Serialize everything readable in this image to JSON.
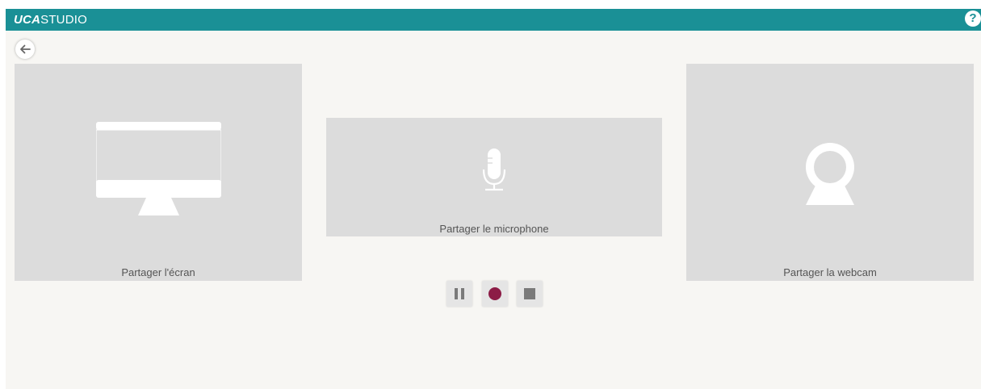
{
  "header": {
    "brand_bold": "UCA",
    "brand_rest": "STUDIO",
    "help_icon": "question-circle-icon",
    "help_label": "?"
  },
  "nav": {
    "back_icon": "arrow-left-icon"
  },
  "sources": [
    {
      "label": "Partager l'écran",
      "icon": "monitor-icon"
    },
    {
      "label": "Partager le microphone",
      "icon": "microphone-icon"
    },
    {
      "label": "Partager la webcam",
      "icon": "webcam-icon"
    }
  ],
  "controls": {
    "pause_icon": "pause-icon",
    "record_icon": "record-icon",
    "stop_icon": "stop-icon"
  },
  "colors": {
    "header_bg": "#1a9096",
    "page_bg": "#f7f6f3",
    "card_bg": "#dcdcdc",
    "record_dot": "#8c1c46",
    "control_glyph": "#7a7a7a"
  }
}
